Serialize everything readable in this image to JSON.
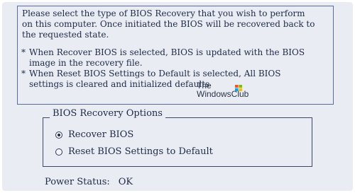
{
  "info": {
    "intro_lines": [
      "Please select the type of BIOS Recovery that you wish to perform",
      "on this computer. Once initiated the BIOS will be recovered back to",
      "the requested state."
    ],
    "bullets": [
      {
        "marker": "*",
        "lines": [
          "When Recover BIOS is selected, BIOS is updated with the BIOS",
          "image in the recovery file."
        ]
      },
      {
        "marker": "*",
        "lines": [
          "When Reset BIOS Settings to Default is selected, All BIOS",
          "settings is cleared and initialized defaults"
        ]
      }
    ]
  },
  "watermark": {
    "line1": "The",
    "line2": "WindowsClub",
    "logo_colors": [
      "#f35325",
      "#81bc06",
      "#05a6f0",
      "#ffba08"
    ]
  },
  "recovery_options": {
    "legend": "BIOS Recovery Options",
    "options": [
      {
        "label": "Recover BIOS",
        "selected": true
      },
      {
        "label": "Reset BIOS Settings to Default",
        "selected": false
      }
    ]
  },
  "status": {
    "label": "Power Status:",
    "value": "OK"
  }
}
